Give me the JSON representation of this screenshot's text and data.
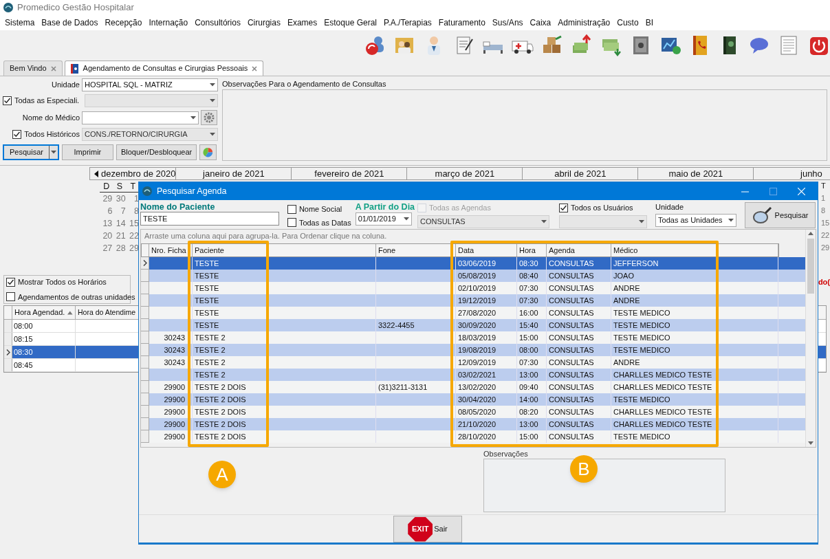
{
  "app_title": "Promedico Gestão Hospitalar",
  "menu": [
    "Sistema",
    "Base de Dados",
    "Recepção",
    "Internação",
    "Consultórios",
    "Cirurgias",
    "Exames",
    "Estoque Geral",
    "P.A./Terapias",
    "Faturamento",
    "Sus/Ans",
    "Caixa",
    "Administração",
    "Custo",
    "BI"
  ],
  "tabs": [
    {
      "label": "Bem Vindo",
      "selected": false
    },
    {
      "label": "Agendamento de Consultas e Cirurgias Pessoais",
      "selected": true
    }
  ],
  "schedule_form": {
    "unit": {
      "label": "Unidade",
      "value": "HOSPITAL SQL - MATRIZ"
    },
    "all_specialties": {
      "label": "Todas as Especiali.",
      "checked": true
    },
    "doctor": {
      "label": "Nome do Médico"
    },
    "all_histories": {
      "label": "Todos Históricos",
      "checked": true,
      "value": "CONS./RETORNO/CIRURGIA"
    },
    "buttons": [
      "Pesquisar",
      "Imprimir",
      "Bloquer/Desbloquear"
    ]
  },
  "notes_panel": {
    "title": "Observações Para o Agendamento de Consultas"
  },
  "calendar": {
    "months": [
      "dezembro de 2020",
      "janeiro de 2021",
      "fevereiro de 2021",
      "março de 2021",
      "abril de 2021",
      "maio de 2021",
      "junho"
    ],
    "weekdays": [
      "D",
      "S",
      "T"
    ],
    "weeks": [
      [
        "29",
        "30",
        "1"
      ],
      [
        "6",
        "7",
        "8"
      ],
      [
        "13",
        "14",
        "15"
      ],
      [
        "20",
        "21",
        "22"
      ],
      [
        "27",
        "28",
        "29"
      ]
    ],
    "right_edge": {
      "weekday": "T",
      "days": [
        "1",
        "8",
        "15",
        "22",
        "29"
      ]
    }
  },
  "options": [
    {
      "label": "Mostrar Todos os Horários",
      "checked": true
    },
    {
      "label": "Agendamentos de outras unidades",
      "checked": false
    }
  ],
  "right_edge_label": "do(",
  "time_grid": {
    "columns": [
      "Hora Agendad.",
      "Hora do Atendime"
    ],
    "rows": [
      {
        "time": "08:00",
        "selected": false
      },
      {
        "time": "08:15",
        "selected": false
      },
      {
        "time": "08:30",
        "selected": true
      },
      {
        "time": "08:45",
        "selected": false
      }
    ]
  },
  "dialog": {
    "title": "Pesquisar Agenda",
    "patient": {
      "label": "Nome do Paciente",
      "value": "TESTE"
    },
    "social_name": {
      "label": "Nome Social",
      "checked": false
    },
    "all_dates": {
      "label": "Todas as Datas",
      "checked": false
    },
    "from_day": {
      "label": "A Partir do Dia",
      "value": "01/01/2019"
    },
    "all_agendas": {
      "label": "Todas as Agendas",
      "checked": false,
      "disabled": true,
      "value": "CONSULTAS"
    },
    "all_users": {
      "label": "Todos os Usuários",
      "checked": true
    },
    "unit": {
      "label": "Unidade",
      "value": "Todas as Unidades"
    },
    "search_button": "Pesquisar",
    "group_hint": "Arraste uma coluna aqui para agrupa-la. Para Ordenar clique na coluna.",
    "columns": [
      "Nro. Ficha",
      "Paciente",
      "Fone",
      "Data",
      "Hora",
      "Agenda",
      "Médico"
    ],
    "rows": [
      {
        "paciente": "TESTE",
        "data": "03/06/2019",
        "hora": "08:30",
        "agenda": "CONSULTAS",
        "medico": "JEFFERSON",
        "selected": true
      },
      {
        "paciente": "TESTE",
        "data": "05/08/2019",
        "hora": "08:40",
        "agenda": "CONSULTAS",
        "medico": "JOAO",
        "selected": false
      },
      {
        "paciente": "TESTE",
        "data": "02/10/2019",
        "hora": "07:30",
        "agenda": "CONSULTAS",
        "medico": "ANDRE",
        "selected": false
      },
      {
        "paciente": "TESTE",
        "data": "19/12/2019",
        "hora": "07:30",
        "agenda": "CONSULTAS",
        "medico": "ANDRE",
        "selected": false
      },
      {
        "paciente": "TESTE",
        "data": "27/08/2020",
        "hora": "16:00",
        "agenda": "CONSULTAS",
        "medico": "TESTE MEDICO",
        "selected": false
      },
      {
        "paciente": "TESTE",
        "fone": "3322-4455",
        "data": "30/09/2020",
        "hora": "15:40",
        "agenda": "CONSULTAS",
        "medico": "TESTE MEDICO",
        "selected": false
      },
      {
        "ficha": "30243",
        "paciente": "TESTE 2",
        "data": "18/03/2019",
        "hora": "15:00",
        "agenda": "CONSULTAS",
        "medico": "TESTE MEDICO",
        "selected": false
      },
      {
        "ficha": "30243",
        "paciente": "TESTE 2",
        "data": "19/08/2019",
        "hora": "08:00",
        "agenda": "CONSULTAS",
        "medico": "TESTE MEDICO",
        "selected": false
      },
      {
        "ficha": "30243",
        "paciente": "TESTE 2",
        "data": "12/09/2019",
        "hora": "07:30",
        "agenda": "CONSULTAS",
        "medico": "ANDRE",
        "selected": false
      },
      {
        "paciente": "TESTE 2",
        "data": "03/02/2021",
        "hora": "13:00",
        "agenda": "CONSULTAS",
        "medico": "CHARLLES MEDICO TESTE",
        "selected": false
      },
      {
        "ficha": "29900",
        "paciente": "TESTE 2 DOIS",
        "fone": "(31)3211-3131",
        "data": "13/02/2020",
        "hora": "09:40",
        "agenda": "CONSULTAS",
        "medico": "CHARLLES MEDICO TESTE",
        "selected": false
      },
      {
        "ficha": "29900",
        "paciente": "TESTE 2 DOIS",
        "data": "30/04/2020",
        "hora": "14:00",
        "agenda": "CONSULTAS",
        "medico": "TESTE MEDICO",
        "selected": false
      },
      {
        "ficha": "29900",
        "paciente": "TESTE 2 DOIS",
        "data": "08/05/2020",
        "hora": "08:20",
        "agenda": "CONSULTAS",
        "medico": "CHARLLES MEDICO TESTE",
        "selected": false
      },
      {
        "ficha": "29900",
        "paciente": "TESTE 2 DOIS",
        "data": "21/10/2020",
        "hora": "13:00",
        "agenda": "CONSULTAS",
        "medico": "CHARLLES MEDICO TESTE",
        "selected": false
      },
      {
        "ficha": "29900",
        "paciente": "TESTE 2 DOIS",
        "data": "28/10/2020",
        "hora": "15:00",
        "agenda": "CONSULTAS",
        "medico": "TESTE MEDICO",
        "selected": false
      }
    ],
    "notes_label": "Observações",
    "exit_sign": "EXIT",
    "exit_button": "Sair"
  },
  "annotations": [
    {
      "label": "A"
    },
    {
      "label": "B"
    }
  ]
}
